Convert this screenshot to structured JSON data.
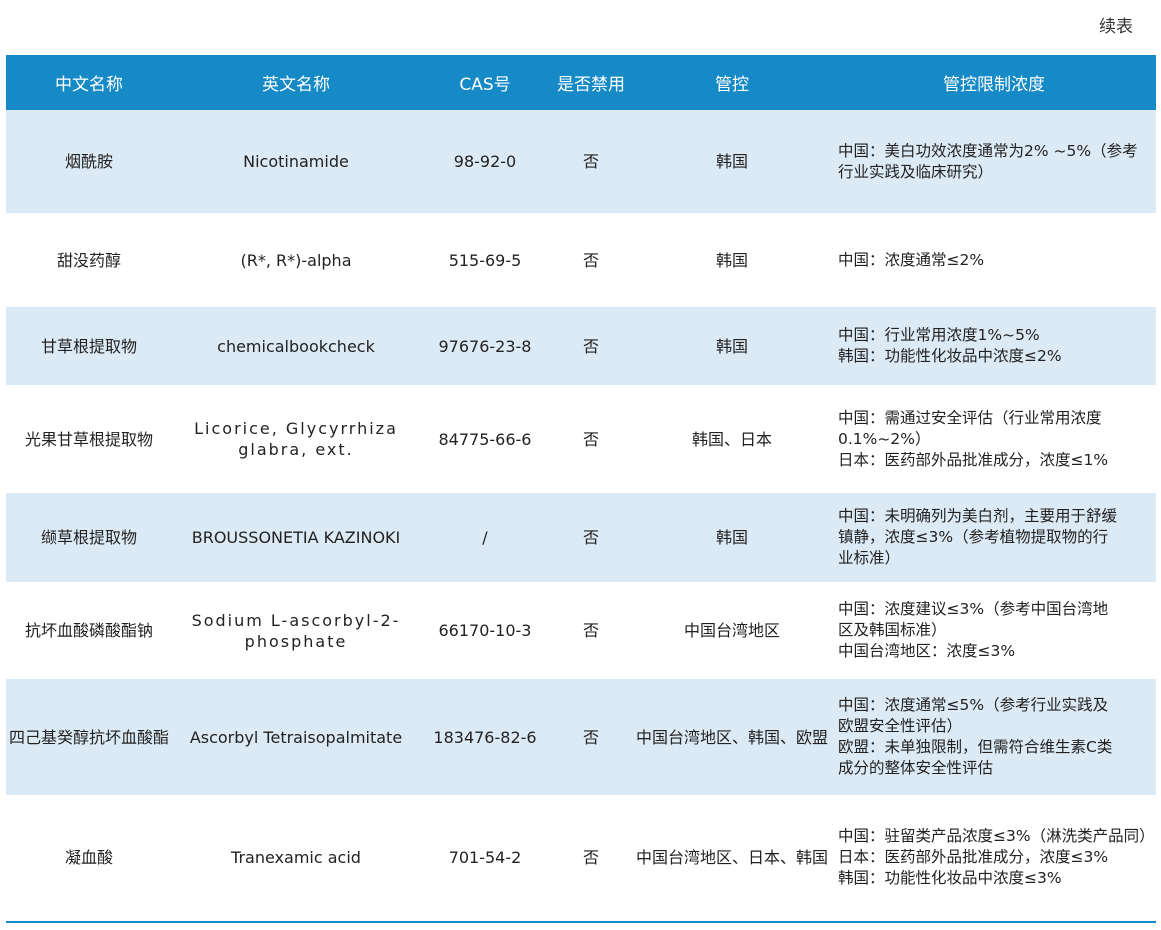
{
  "caption": "续表",
  "headers": [
    "中文名称",
    "英文名称",
    "CAS号",
    "是否禁用",
    "管控",
    "管控限制浓度"
  ],
  "rows": [
    {
      "cn": "烟酰胺",
      "en": "Nicotinamide",
      "cas": "98-92-0",
      "banned": "否",
      "control": "韩国",
      "limit": [
        "中国：美白功效浓度通常为2% ~5%（参考",
        "行业实践及临床研究）"
      ]
    },
    {
      "cn": "甜没药醇",
      "en": "(R*, R*)-alpha",
      "cas": "515-69-5",
      "banned": "否",
      "control": "韩国",
      "limit": [
        "中国：浓度通常≤2%"
      ]
    },
    {
      "cn": "甘草根提取物",
      "en": "chemicalbookcheck",
      "cas": "97676-23-8",
      "banned": "否",
      "control": "韩国",
      "limit": [
        "中国：行业常用浓度1%~5%",
        "韩国：功能性化妆品中浓度≤2%"
      ]
    },
    {
      "cn": "光果甘草根提取物",
      "en": "Licorice, Glycyrrhiza glabra, ext.",
      "cas": "84775-66-6",
      "banned": "否",
      "control": "韩国、日本",
      "limit": [
        "中国：需通过安全评估（行业常用浓度",
        "0.1%~2%）",
        "日本：医药部外品批准成分，浓度≤1%"
      ]
    },
    {
      "cn": "缬草根提取物",
      "en": "BROUSSONETIA KAZINOKI",
      "cas": "/",
      "banned": "否",
      "control": "韩国",
      "limit": [
        "中国：未明确列为美白剂，主要用于舒缓",
        "镇静，浓度≤3%（参考植物提取物的行",
        "业标准）"
      ]
    },
    {
      "cn": "抗坏血酸磷酸酯钠",
      "en": "Sodium L-ascorbyl-2-phosphate",
      "cas": "66170-10-3",
      "banned": "否",
      "control": "中国台湾地区",
      "limit": [
        "中国：浓度建议≤3%（参考中国台湾地",
        "区及韩国标准）",
        "中国台湾地区：浓度≤3%"
      ]
    },
    {
      "cn": "四己基癸醇抗坏血酸酯",
      "en": "Ascorbyl Tetraisopalmitate",
      "cas": "183476-82-6",
      "banned": "否",
      "control": "中国台湾地区、韩国、欧盟",
      "limit": [
        "中国：浓度通常≤5%（参考行业实践及",
        "欧盟安全性评估）",
        "欧盟：未单独限制，但需符合维生素C类",
        "成分的整体安全性评估"
      ]
    },
    {
      "cn": "凝血酸",
      "en": "Tranexamic acid",
      "cas": "701-54-2",
      "banned": "否",
      "control": "中国台湾地区、日本、韩国",
      "limit": [
        "中国：驻留类产品浓度≤3%（淋洗类产品同）",
        "日本：医药部外品批准成分，浓度≤3%",
        "韩国：功能性化妆品中浓度≤3%"
      ]
    }
  ]
}
